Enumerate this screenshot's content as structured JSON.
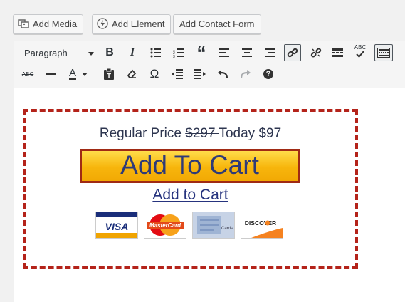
{
  "media_buttons": {
    "add_media": "Add Media",
    "add_element": "Add Element",
    "add_contact_form": "Add Contact Form"
  },
  "toolbar": {
    "format_select": "Paragraph",
    "icons": [
      "bold-icon",
      "italic-icon",
      "bullet-list-icon",
      "numbered-list-icon",
      "blockquote-icon",
      "align-left-icon",
      "align-center-icon",
      "align-right-icon",
      "insert-link-icon",
      "remove-link-icon",
      "read-more-icon",
      "spellcheck-icon",
      "toolbar-toggle-icon",
      "strikethrough-icon",
      "horizontal-line-icon",
      "text-color-icon",
      "paste-as-text-icon",
      "clear-formatting-icon",
      "special-character-icon",
      "outdent-icon",
      "indent-icon",
      "undo-icon",
      "redo-icon",
      "help-icon"
    ],
    "bold": "B",
    "italic": "I",
    "quote": "“",
    "text_color": "A",
    "omega": "Ω",
    "help": "?",
    "spellcheck": "ABC",
    "strike": "ABC"
  },
  "content": {
    "price_label": "Regular Price ",
    "old_price": "$297 ",
    "today_label": "Today $97",
    "cart_button": "Add To Cart",
    "cart_link": "Add to Cart",
    "cards": {
      "visa": "VISA",
      "mastercard": "MasterCard",
      "amex_small": "Cards",
      "discover": "DISCOVER"
    }
  },
  "colors": {
    "dashed_border": "#b4231a",
    "cart_button": "#f7b50c",
    "cart_text": "#2e3a78"
  }
}
